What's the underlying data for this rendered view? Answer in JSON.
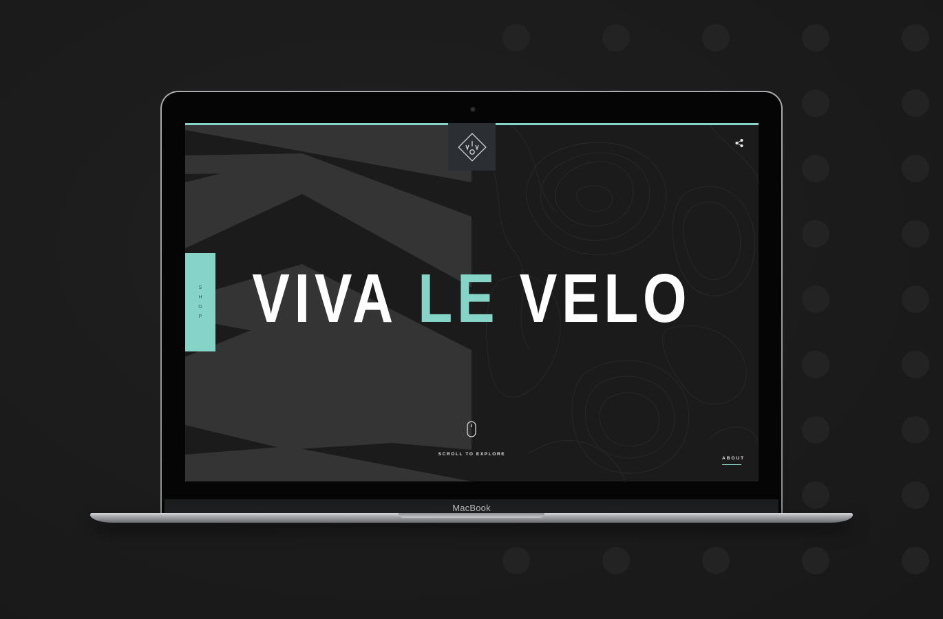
{
  "colors": {
    "accent": "#86d4c8",
    "screen_bg": "#1b1b1b",
    "chevron_band": "#343434",
    "logo_box": "#2b2f33",
    "text": "#ffffff",
    "contour": "#2b2b2b",
    "page_bg": "#1c1c1c"
  },
  "device": {
    "brand_label": "MacBook"
  },
  "site": {
    "headline": {
      "word1": "VIVA",
      "word2": "LE",
      "word3": "VELO"
    },
    "side_tab": {
      "label": "SHOP"
    },
    "scroll_hint": "SCROLL TO EXPLORE",
    "nav": {
      "about": "ABOUT"
    },
    "icons": {
      "logo": "vlv-diamond-logo-icon",
      "share": "share-icon",
      "scroll": "mouse-scroll-icon"
    }
  }
}
